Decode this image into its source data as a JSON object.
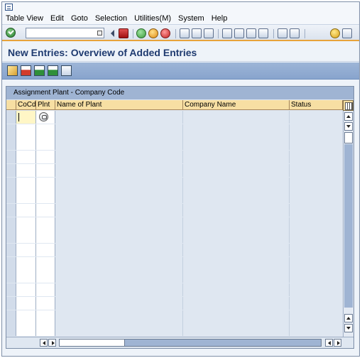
{
  "menubar": {
    "items": [
      {
        "label": "Table View"
      },
      {
        "label": "Edit"
      },
      {
        "label": "Goto"
      },
      {
        "label": "Selection"
      },
      {
        "label": "Utilities(M)"
      },
      {
        "label": "System"
      },
      {
        "label": "Help"
      }
    ]
  },
  "toolbar": {
    "command_field_value": "",
    "icons": [
      "enter-icon",
      "back-icon",
      "save-icon",
      "back-nav-icon",
      "exit-icon",
      "cancel-icon",
      "print-icon",
      "find-icon",
      "find-next-icon",
      "first-page-icon",
      "previous-page-icon",
      "next-page-icon",
      "last-page-icon",
      "create-session-icon",
      "shortcut-icon",
      "help-icon",
      "layout-icon"
    ],
    "accent_color": "#e8a33b"
  },
  "page": {
    "title": "New Entries: Overview of Added Entries"
  },
  "app_toolbar": {
    "icons": [
      "display-change-icon",
      "delete-icon",
      "select-all-icon",
      "select-block-icon",
      "deselect-all-icon"
    ]
  },
  "table": {
    "title": "Assignment Plant - Company Code",
    "columns": [
      "CoCd",
      "Plnt",
      "Name of Plant",
      "Company Name",
      "Status"
    ],
    "row_count": 17,
    "first_row_cocd": "",
    "first_row_plnt_icon": "value-help-icon"
  }
}
